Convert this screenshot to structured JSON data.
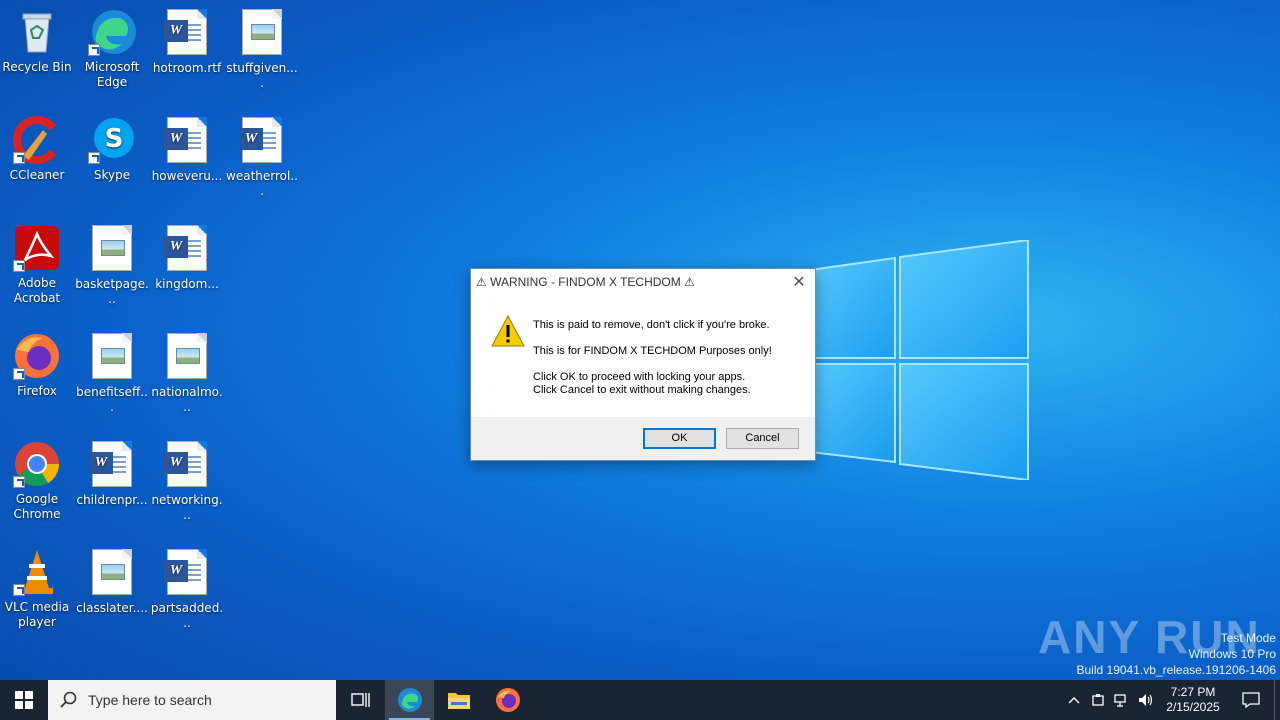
{
  "desktop": {
    "icons": [
      {
        "label": "Recycle Bin",
        "icon": "recycle-bin-icon"
      },
      {
        "label": "Microsoft Edge",
        "icon": "edge-icon"
      },
      {
        "label": "hotroom.rtf",
        "icon": "word-doc-icon"
      },
      {
        "label": "stuffgiven....",
        "icon": "image-doc-icon"
      },
      {
        "label": "CCleaner",
        "icon": "ccleaner-icon"
      },
      {
        "label": "Skype",
        "icon": "skype-icon"
      },
      {
        "label": "howeveru...",
        "icon": "word-doc-icon"
      },
      {
        "label": "weatherrol...",
        "icon": "word-doc-icon"
      },
      {
        "label": "Adobe Acrobat",
        "icon": "acrobat-icon"
      },
      {
        "label": "basketpage...",
        "icon": "image-doc-icon"
      },
      {
        "label": "kingdom...",
        "icon": "word-doc-icon"
      },
      {
        "label": "Firefox",
        "icon": "firefox-icon"
      },
      {
        "label": "benefitseff...",
        "icon": "image-doc-icon"
      },
      {
        "label": "nationalmo...",
        "icon": "image-doc-icon"
      },
      {
        "label": "Google Chrome",
        "icon": "chrome-icon"
      },
      {
        "label": "childrenpr...",
        "icon": "word-doc-icon"
      },
      {
        "label": "networking...",
        "icon": "word-doc-icon"
      },
      {
        "label": "VLC media player",
        "icon": "vlc-icon"
      },
      {
        "label": "classlater....",
        "icon": "image-doc-icon"
      },
      {
        "label": "partsadded...",
        "icon": "word-doc-icon"
      }
    ]
  },
  "dialog": {
    "title": "⚠ WARNING - FINDOM X TECHDOM ⚠",
    "line1": "This is paid to remove, don't click if you're broke.",
    "line2": "This is for FINDOM X TECHDOM Purposes only!",
    "line3": "Click OK to proceed with locking your apps.",
    "line4": "Click Cancel to exit without making changes.",
    "ok_label": "OK",
    "cancel_label": "Cancel"
  },
  "watermark": {
    "brand": "ANY RUN",
    "mode": "Test Mode",
    "edition": "Windows 10 Pro",
    "build": "Build 19041.vb_release.191206-1406"
  },
  "taskbar": {
    "search_placeholder": "Type here to search",
    "time": "7:27 PM",
    "date": "2/15/2025"
  },
  "colors": {
    "accent": "#0078d7",
    "taskbar": "#1a2433"
  }
}
